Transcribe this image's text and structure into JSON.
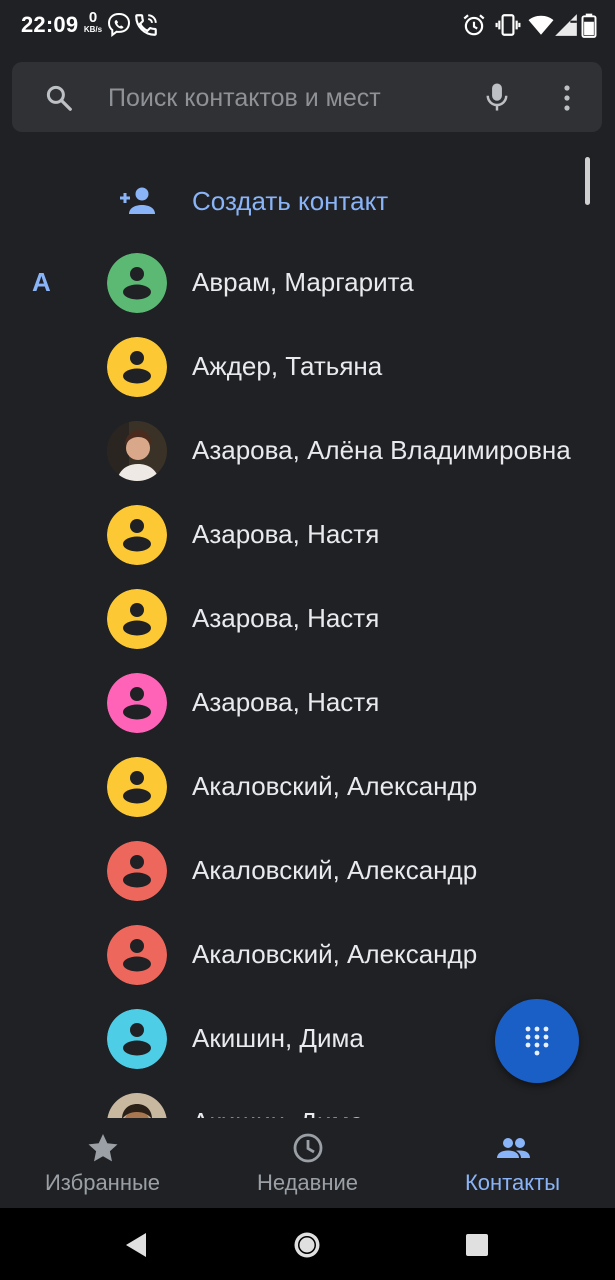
{
  "status_bar": {
    "time": "22:09",
    "net_speed_value": "0",
    "net_speed_unit": "KB/s",
    "icons": [
      "viber-icon",
      "call-icon",
      "alarm-icon",
      "vibrate-icon",
      "wifi-icon",
      "signal-icon",
      "battery-icon"
    ]
  },
  "search": {
    "placeholder": "Поиск контактов и мест",
    "icons": [
      "search-icon",
      "mic-icon",
      "more-vert-icon"
    ]
  },
  "create_contact": {
    "label": "Создать контакт",
    "icon": "add-person-icon"
  },
  "contacts": [
    {
      "letter": "А",
      "name": "Аврам, Маргарита",
      "avatar": "placeholder",
      "color": "#5bb974"
    },
    {
      "letter": "",
      "name": "Аждер, Татьяна",
      "avatar": "placeholder",
      "color": "#fcc934"
    },
    {
      "letter": "",
      "name": "Азарова, Алёна Владимировна",
      "avatar": "photo",
      "color": "#6b5a4a"
    },
    {
      "letter": "",
      "name": "Азарова, Настя",
      "avatar": "placeholder",
      "color": "#fcc934"
    },
    {
      "letter": "",
      "name": "Азарова, Настя",
      "avatar": "placeholder",
      "color": "#fcc934"
    },
    {
      "letter": "",
      "name": "Азарова, Настя",
      "avatar": "placeholder",
      "color": "#ff63b8"
    },
    {
      "letter": "",
      "name": "Акаловский, Александр",
      "avatar": "placeholder",
      "color": "#fcc934"
    },
    {
      "letter": "",
      "name": "Акаловский, Александр",
      "avatar": "placeholder",
      "color": "#ee675c"
    },
    {
      "letter": "",
      "name": "Акаловский, Александр",
      "avatar": "placeholder",
      "color": "#ee675c"
    },
    {
      "letter": "",
      "name": "Акишин, Дима",
      "avatar": "placeholder",
      "color": "#4ecde6"
    },
    {
      "letter": "",
      "name": "Акишин, Дима",
      "avatar": "photo",
      "color": "#8a6a4a"
    }
  ],
  "fab": {
    "icon": "dialpad-icon"
  },
  "bottom_nav": [
    {
      "label": "Избранные",
      "icon": "star-icon",
      "active": false
    },
    {
      "label": "Недавние",
      "icon": "clock-icon",
      "active": false
    },
    {
      "label": "Контакты",
      "icon": "people-icon",
      "active": true
    }
  ],
  "system_nav": [
    "back-icon",
    "home-icon",
    "recents-icon"
  ],
  "colors": {
    "background": "#202124",
    "search_bg": "#303134",
    "accent": "#8ab4f8",
    "fab": "#1a5fc6",
    "text": "#e8eaed",
    "muted": "#9aa0a6"
  }
}
